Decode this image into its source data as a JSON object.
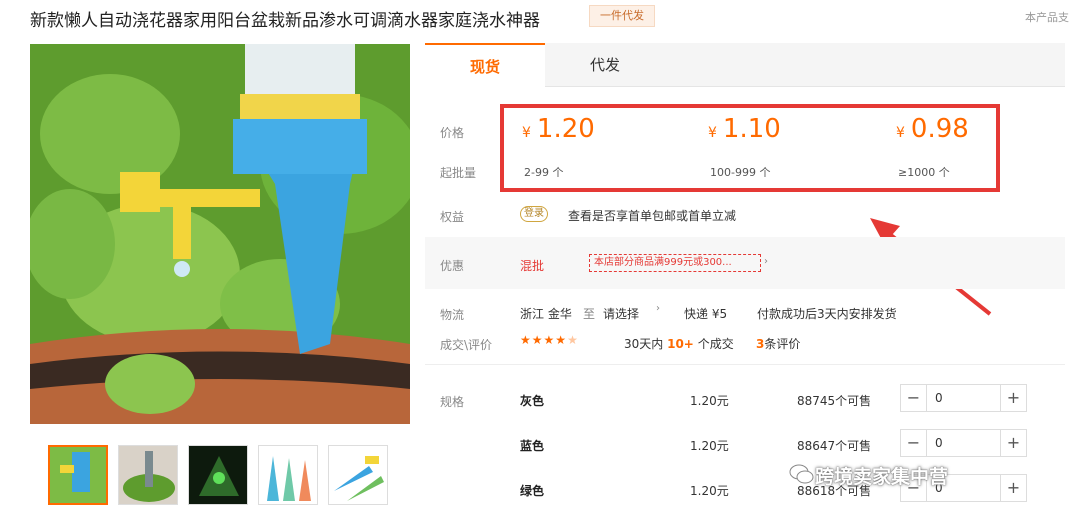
{
  "header": {
    "title": "新款懒人自动浇花器家用阳台盆栽新品渗水可调滴水器家庭浇水神器",
    "badge": "一件代发",
    "right_note": "本产品支"
  },
  "tabs": [
    {
      "label": "现货"
    },
    {
      "label": "代发"
    }
  ],
  "pricing": {
    "price_label": "价格",
    "moq_label": "起批量",
    "currency": "¥",
    "tiers": [
      {
        "price": "1.20",
        "qty": "2-99 个"
      },
      {
        "price": "1.10",
        "qty": "100-999 个"
      },
      {
        "price": "0.98",
        "qty": "≥1000 个"
      }
    ]
  },
  "benefit": {
    "label": "权益",
    "icon_text": "登录",
    "text": "查看是否享首单包邮或首单立减"
  },
  "promo": {
    "label": "优惠",
    "type": "混批",
    "tag": "本店部分商品满999元或300..."
  },
  "logistics": {
    "label": "物流",
    "origin": "浙江 金华",
    "to": "至",
    "select": "请选择",
    "express": "快递 ¥5",
    "ship_note": "付款成功后3天内安排发货"
  },
  "reviews": {
    "label": "成交\\评价",
    "rating": 4.5,
    "deals_prefix": "30天内",
    "deals_count": "10+",
    "deals_suffix": "个成交",
    "review_count": "3",
    "review_suffix": "条评价"
  },
  "specs": {
    "label": "规格",
    "rows": [
      {
        "name": "灰色",
        "price": "1.20元",
        "stock": "88745个可售",
        "qty": "0"
      },
      {
        "name": "蓝色",
        "price": "1.20元",
        "stock": "88647个可售",
        "qty": "0"
      },
      {
        "name": "绿色",
        "price": "1.20元",
        "stock": "88618个可售",
        "qty": "0"
      }
    ]
  },
  "watermark": "跨境卖家集中营",
  "colors": {
    "accent": "#ff6a00",
    "highlight_box": "#e53935"
  },
  "icons": [
    "dropdown-arrow-icon",
    "star-icon",
    "minus-icon",
    "plus-icon",
    "chat-bubble-icon"
  ]
}
